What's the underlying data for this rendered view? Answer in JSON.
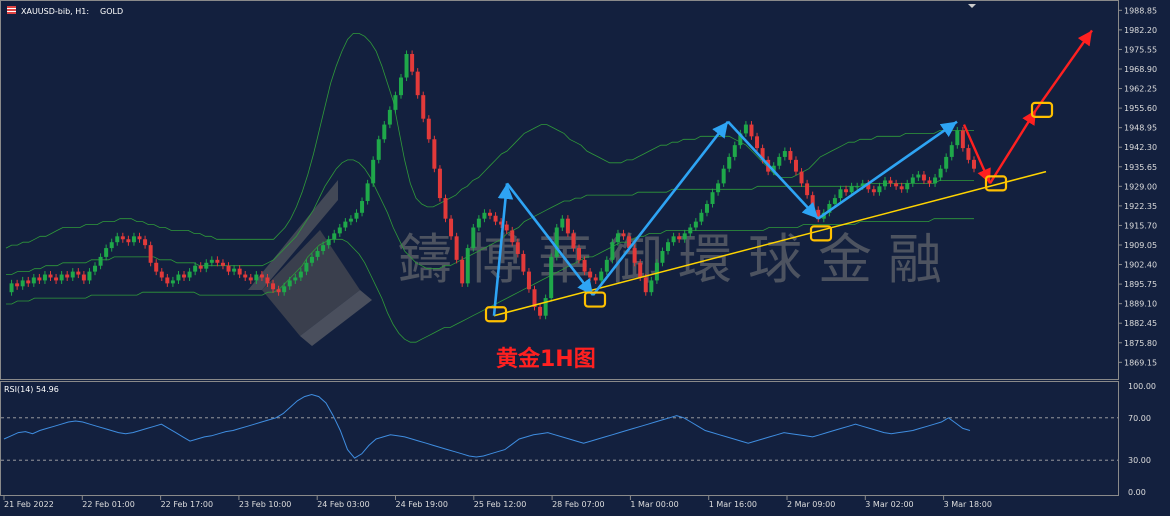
{
  "header": {
    "symbol": "XAUUSD-bib, H1:",
    "name": "GOLD"
  },
  "watermark": "鑄博華御環球金融",
  "annotation": "黄金1H图",
  "rsi_panel": {
    "label": "RSI(14) 54.96",
    "ticks": [
      "100.00",
      "70.00",
      "30.00",
      "0.00"
    ],
    "tick_values": [
      100,
      70,
      30,
      0
    ],
    "levels": [
      70,
      30
    ]
  },
  "price_axis": {
    "ticks": [
      "1988.85",
      "1982.20",
      "1975.55",
      "1968.90",
      "1962.25",
      "1955.60",
      "1948.95",
      "1942.30",
      "1935.65",
      "1929.00",
      "1922.35",
      "1915.70",
      "1909.05",
      "1902.40",
      "1895.75",
      "1889.10",
      "1882.45",
      "1875.80",
      "1869.15"
    ]
  },
  "time_axis": {
    "ticks": [
      "21 Feb 2022",
      "22 Feb 01:00",
      "22 Feb 17:00",
      "23 Feb 10:00",
      "24 Feb 03:00",
      "24 Feb 19:00",
      "25 Feb 12:00",
      "28 Feb 07:00",
      "1 Mar 00:00",
      "1 Mar 16:00",
      "2 Mar 09:00",
      "3 Mar 02:00",
      "3 Mar 18:00"
    ]
  },
  "chart_data": {
    "type": "candlestick",
    "title": "XAUUSD-bib, H1: GOLD",
    "ylim": [
      1864.5,
      1991
    ],
    "price_series": [
      1893,
      1896,
      1895,
      1897,
      1896,
      1898,
      1897,
      1899,
      1898,
      1897,
      1899,
      1898,
      1900,
      1899,
      1897,
      1900,
      1902,
      1905,
      1908,
      1910,
      1912,
      1911,
      1910,
      1912,
      1911,
      1909,
      1903,
      1900,
      1898,
      1896,
      1897,
      1899,
      1898,
      1900,
      1902,
      1901,
      1903,
      1904,
      1903,
      1902,
      1900,
      1901,
      1899,
      1898,
      1897,
      1899,
      1898,
      1896,
      1894,
      1893,
      1895,
      1897,
      1898,
      1900,
      1903,
      1905,
      1907,
      1909,
      1911,
      1913,
      1915,
      1917,
      1918,
      1920,
      1924,
      1930,
      1938,
      1945,
      1950,
      1955,
      1960,
      1966,
      1974,
      1968,
      1960,
      1952,
      1945,
      1935,
      1925,
      1918,
      1912,
      1904,
      1896,
      1908,
      1915,
      1918,
      1920,
      1919,
      1917,
      1916,
      1914,
      1910,
      1906,
      1900,
      1894,
      1888,
      1885,
      1891,
      1905,
      1915,
      1918,
      1913,
      1908,
      1904,
      1900,
      1898,
      1897,
      1900,
      1904,
      1910,
      1913,
      1912,
      1908,
      1903,
      1898,
      1893,
      1897,
      1903,
      1907,
      1910,
      1912,
      1911,
      1913,
      1915,
      1917,
      1920,
      1923,
      1927,
      1930,
      1935,
      1939,
      1943,
      1947,
      1950,
      1946,
      1942,
      1938,
      1934,
      1936,
      1939,
      1941,
      1938,
      1934,
      1930,
      1926,
      1921,
      1918,
      1920,
      1923,
      1925,
      1928,
      1927,
      1929,
      1929,
      1930,
      1928,
      1927,
      1929,
      1931,
      1930,
      1929,
      1928,
      1930,
      1932,
      1933,
      1931,
      1930,
      1932,
      1935,
      1939,
      1943,
      1948,
      1942,
      1938,
      1935
    ],
    "bollinger_upper": [
      1908,
      1909,
      1909,
      1910,
      1910,
      1911,
      1912,
      1912,
      1913,
      1914,
      1915,
      1915,
      1915,
      1915,
      1916,
      1916,
      1916,
      1917,
      1917,
      1917,
      1918,
      1918,
      1918,
      1917,
      1917,
      1916,
      1916,
      1915,
      1915,
      1914,
      1914,
      1914,
      1914,
      1913,
      1913,
      1912,
      1912,
      1911,
      1911,
      1911,
      1911,
      1911,
      1911,
      1911,
      1911,
      1911,
      1911,
      1911,
      1913,
      1915,
      1918,
      1922,
      1927,
      1933,
      1940,
      1948,
      1956,
      1964,
      1970,
      1975,
      1979,
      1981,
      1981,
      1980,
      1978,
      1975,
      1970,
      1964,
      1958,
      1948,
      1938,
      1930,
      1925,
      1923,
      1922,
      1922,
      1923,
      1924,
      1925,
      1926,
      1928,
      1929,
      1931,
      1932,
      1934,
      1936,
      1938,
      1940,
      1941,
      1943,
      1945,
      1947,
      1948,
      1949,
      1950,
      1950,
      1949,
      1948,
      1947,
      1945,
      1944,
      1943,
      1941,
      1940,
      1939,
      1938,
      1937,
      1937,
      1937,
      1938,
      1938,
      1939,
      1940,
      1941,
      1942,
      1943,
      1943,
      1944,
      1944,
      1945,
      1945,
      1945,
      1946,
      1946,
      1946,
      1946,
      1946,
      1946,
      1945,
      1944,
      1943,
      1941,
      1939,
      1937,
      1935,
      1933,
      1932,
      1932,
      1932,
      1933,
      1934,
      1935,
      1937,
      1939,
      1940,
      1941,
      1942,
      1943,
      1944,
      1944,
      1945,
      1945,
      1945,
      1946,
      1946,
      1946,
      1946,
      1946,
      1947,
      1947,
      1947,
      1947,
      1947,
      1947,
      1948,
      1948,
      1948,
      1948,
      1948,
      1948,
      1948
    ],
    "bollinger_middle": [
      1899,
      1899,
      1900,
      1900,
      1900,
      1901,
      1901,
      1902,
      1902,
      1902,
      1903,
      1903,
      1903,
      1903,
      1903,
      1904,
      1904,
      1904,
      1904,
      1905,
      1905,
      1905,
      1905,
      1905,
      1905,
      1905,
      1905,
      1904,
      1904,
      1904,
      1903,
      1903,
      1903,
      1903,
      1902,
      1902,
      1902,
      1902,
      1902,
      1902,
      1902,
      1902,
      1902,
      1902,
      1902,
      1902,
      1903,
      1904,
      1906,
      1908,
      1910,
      1912,
      1915,
      1918,
      1921,
      1925,
      1929,
      1932,
      1935,
      1937,
      1938,
      1938,
      1937,
      1935,
      1932,
      1928,
      1924,
      1920,
      1915,
      1911,
      1907,
      1905,
      1903,
      1902,
      1901,
      1901,
      1901,
      1902,
      1902,
      1903,
      1904,
      1905,
      1906,
      1907,
      1908,
      1909,
      1910,
      1911,
      1913,
      1914,
      1915,
      1917,
      1918,
      1919,
      1920,
      1921,
      1922,
      1923,
      1924,
      1924,
      1925,
      1925,
      1926,
      1926,
      1926,
      1926,
      1926,
      1926,
      1926,
      1926,
      1926,
      1927,
      1927,
      1927,
      1927,
      1927,
      1927,
      1928,
      1928,
      1928,
      1928,
      1928,
      1928,
      1928,
      1928,
      1928,
      1928,
      1928,
      1928,
      1928,
      1928,
      1928,
      1929,
      1929,
      1929,
      1929,
      1929,
      1929,
      1929,
      1929,
      1929,
      1929,
      1929,
      1929,
      1929,
      1929,
      1929,
      1929,
      1929,
      1929,
      1929,
      1930,
      1930,
      1930,
      1930,
      1930,
      1930,
      1930,
      1930,
      1930,
      1930,
      1930,
      1930,
      1930,
      1931,
      1931,
      1931,
      1931,
      1931,
      1931,
      1931
    ],
    "bollinger_lower": [
      1889,
      1889,
      1890,
      1890,
      1890,
      1891,
      1891,
      1891,
      1891,
      1891,
      1891,
      1891,
      1891,
      1891,
      1891,
      1892,
      1892,
      1892,
      1892,
      1892,
      1892,
      1892,
      1892,
      1892,
      1893,
      1893,
      1893,
      1893,
      1893,
      1893,
      1893,
      1893,
      1893,
      1893,
      1892,
      1892,
      1892,
      1892,
      1892,
      1892,
      1892,
      1892,
      1892,
      1892,
      1892,
      1892,
      1893,
      1893,
      1894,
      1896,
      1898,
      1900,
      1902,
      1905,
      1907,
      1909,
      1910,
      1911,
      1911,
      1911,
      1910,
      1908,
      1906,
      1903,
      1899,
      1895,
      1891,
      1886,
      1882,
      1879,
      1877,
      1876,
      1876,
      1877,
      1878,
      1879,
      1880,
      1881,
      1881,
      1882,
      1883,
      1884,
      1885,
      1886,
      1887,
      1888,
      1889,
      1890,
      1891,
      1892,
      1893,
      1894,
      1895,
      1896,
      1897,
      1898,
      1899,
      1900,
      1901,
      1902,
      1903,
      1904,
      1905,
      1905,
      1906,
      1907,
      1908,
      1909,
      1910,
      1910,
      1911,
      1912,
      1912,
      1913,
      1913,
      1913,
      1914,
      1914,
      1914,
      1914,
      1914,
      1914,
      1914,
      1914,
      1914,
      1914,
      1914,
      1914,
      1914,
      1914,
      1914,
      1914,
      1914,
      1914,
      1915,
      1915,
      1915,
      1915,
      1915,
      1915,
      1916,
      1916,
      1916,
      1916,
      1916,
      1916,
      1916,
      1916,
      1916,
      1916,
      1917,
      1917,
      1917,
      1917,
      1917,
      1917,
      1917,
      1917,
      1917,
      1917,
      1917,
      1917,
      1917,
      1918,
      1918,
      1918,
      1918,
      1918,
      1918,
      1918,
      1918
    ],
    "rsi_series": [
      50,
      53,
      56,
      57,
      55,
      58,
      60,
      62,
      64,
      66,
      67,
      66,
      64,
      62,
      60,
      58,
      56,
      55,
      56,
      58,
      60,
      62,
      64,
      60,
      56,
      52,
      48,
      50,
      52,
      53,
      55,
      57,
      58,
      60,
      62,
      64,
      66,
      68,
      70,
      74,
      80,
      86,
      90,
      92,
      90,
      84,
      72,
      58,
      40,
      32,
      36,
      44,
      50,
      52,
      54,
      53,
      52,
      50,
      48,
      46,
      44,
      42,
      40,
      38,
      36,
      34,
      33,
      34,
      36,
      38,
      40,
      45,
      50,
      52,
      54,
      55,
      56,
      54,
      52,
      50,
      48,
      46,
      48,
      50,
      52,
      54,
      56,
      58,
      60,
      62,
      64,
      66,
      68,
      70,
      72,
      70,
      66,
      62,
      58,
      56,
      54,
      52,
      50,
      48,
      46,
      48,
      50,
      52,
      54,
      56,
      55,
      54,
      53,
      52,
      54,
      56,
      58,
      60,
      62,
      64,
      62,
      60,
      58,
      56,
      55,
      56,
      57,
      58,
      60,
      62,
      64,
      66,
      70,
      65,
      60,
      58
    ],
    "zigzag_blue": [
      [
        1889,
        1885
      ],
      [
        1930,
        1930
      ],
      [
        1909,
        1892
      ],
      [
        1951,
        1950
      ],
      [
        1920,
        1918
      ],
      [
        1951,
        1952
      ]
    ],
    "trendline_start": 1885,
    "trendline_end": 1934,
    "projection_red": [
      1950,
      1930,
      1955,
      1982
    ]
  },
  "colors": {
    "background": "#13203e",
    "bull": "#1fa84a",
    "bear": "#e23a3a",
    "band": "#2f9a3a",
    "trend": "#ffd400",
    "zigzag": "#2ea4f4",
    "projection": "#ff2020",
    "marker": "#ffc000",
    "rsi": "#3f8de0",
    "axis_text": "#dddddd"
  }
}
